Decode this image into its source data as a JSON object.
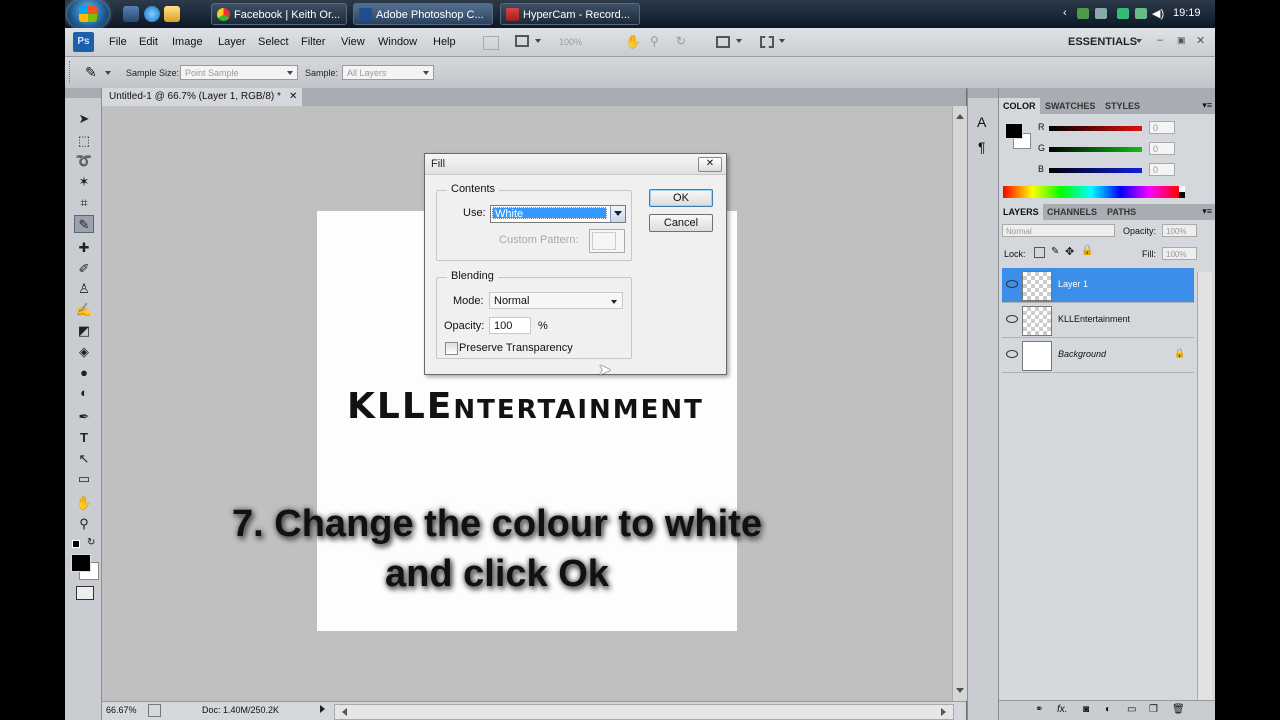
{
  "taskbar": {
    "tasks": [
      {
        "label": "Facebook | Keith Or...",
        "active": false
      },
      {
        "label": "Adobe Photoshop C...",
        "active": true
      },
      {
        "label": "HyperCam - Record...",
        "active": false
      }
    ],
    "clock": "19:19"
  },
  "menubar": {
    "app_badge": "Ps",
    "items": [
      "File",
      "Edit",
      "Image",
      "Layer",
      "Select",
      "Filter",
      "View",
      "Window",
      "Help"
    ],
    "zoom": "100%",
    "workspace": "ESSENTIALS"
  },
  "options_bar": {
    "sample_size_label": "Sample Size:",
    "sample_size_value": "Point Sample",
    "sample_label": "Sample:",
    "sample_value": "All Layers"
  },
  "document": {
    "tab_title": "Untitled-1 @ 66.7% (Layer 1, RGB/8) *",
    "logo_big": "KLLE",
    "logo_small": "NTERTAINMENT",
    "caption_line1": "7.  Change the colour to white",
    "caption_line2": "and click  Ok",
    "status_zoom": "66.67%",
    "status_doc": "Doc: 1.40M/250.2K"
  },
  "fill_dialog": {
    "title": "Fill",
    "contents_label": "Contents",
    "use_label": "Use:",
    "use_value": "White",
    "custom_pattern_label": "Custom Pattern:",
    "blending_label": "Blending",
    "mode_label": "Mode:",
    "mode_value": "Normal",
    "opacity_label": "Opacity:",
    "opacity_value": "100",
    "opacity_unit": "%",
    "preserve_label": "Preserve Transparency",
    "preserve_checked": false,
    "ok_label": "OK",
    "cancel_label": "Cancel"
  },
  "color_panel": {
    "tabs": [
      "COLOR",
      "SWATCHES",
      "STYLES"
    ],
    "channels": [
      {
        "name": "R",
        "value": "0",
        "color": "#d01010"
      },
      {
        "name": "G",
        "value": "0",
        "color": "#10a010"
      },
      {
        "name": "B",
        "value": "0",
        "color": "#1020d0"
      }
    ]
  },
  "layers_panel": {
    "tabs": [
      "LAYERS",
      "CHANNELS",
      "PATHS"
    ],
    "blend_mode": "Normal",
    "opacity_label": "Opacity:",
    "opacity_value": "100%",
    "lock_label": "Lock:",
    "fill_label": "Fill:",
    "fill_value": "100%",
    "layers": [
      {
        "name": "Layer 1",
        "selected": true
      },
      {
        "name": "KLLEntertainment",
        "selected": false
      },
      {
        "name": "Background",
        "selected": false
      }
    ]
  }
}
